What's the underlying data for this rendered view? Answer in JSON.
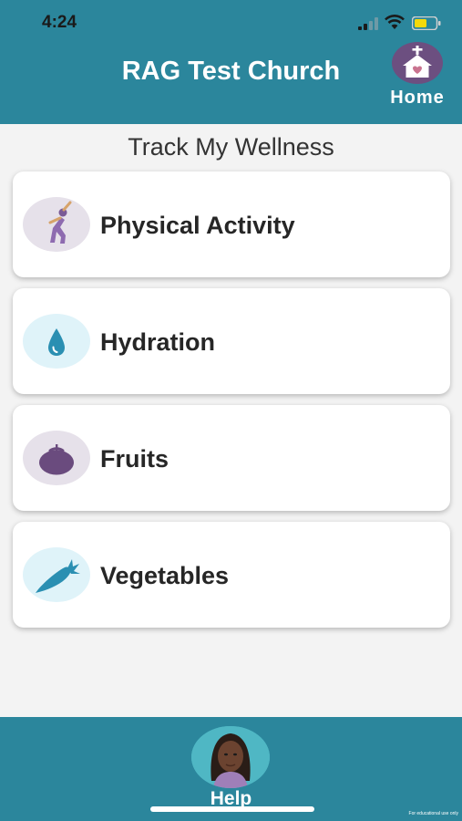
{
  "status_bar": {
    "time": "4:24",
    "icons": [
      "signal-icon",
      "wifi-icon",
      "battery-icon"
    ],
    "battery_color": "#f5d90a"
  },
  "header": {
    "title": "RAG Test Church",
    "home_label": "Home",
    "background_color": "#2b869c",
    "home_icon": "church-home-icon"
  },
  "main": {
    "section_title": "Track My Wellness",
    "items": [
      {
        "label": "Physical Activity",
        "icon": "stretching-person-icon",
        "icon_bg": "#e6e1ea"
      },
      {
        "label": "Hydration",
        "icon": "water-drop-icon",
        "icon_bg": "#dff3f9"
      },
      {
        "label": "Fruits",
        "icon": "fruit-icon",
        "icon_bg": "#e6e1ea"
      },
      {
        "label": "Vegetables",
        "icon": "carrot-icon",
        "icon_bg": "#dff3f9"
      }
    ]
  },
  "footer": {
    "help_label": "Help",
    "avatar_icon": "assistant-avatar",
    "fine_print": "For educational use only"
  }
}
